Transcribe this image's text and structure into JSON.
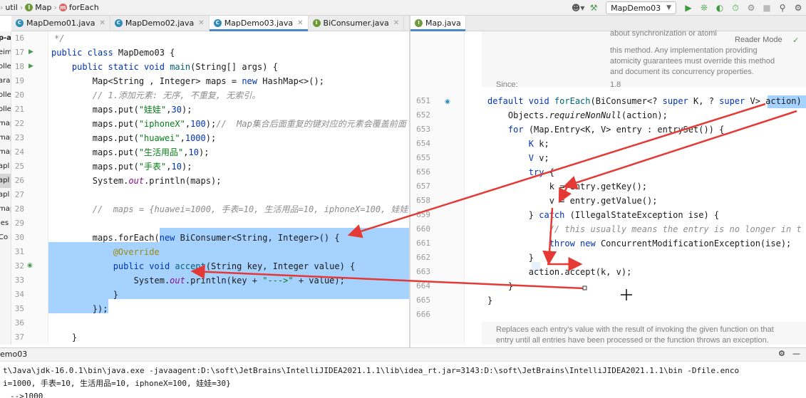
{
  "breadcrumb": {
    "items": [
      "util",
      "Map",
      "forEach"
    ]
  },
  "toolbar": {
    "run_config": "MapDemo03"
  },
  "left_tabs": [
    {
      "label": "MapDemo01.java"
    },
    {
      "label": "MapDemo02.java"
    },
    {
      "label": "MapDemo03.java"
    },
    {
      "label": "BiConsumer.java"
    }
  ],
  "right_tabs": [
    {
      "label": "Map.java"
    }
  ],
  "project_strip": [
    "p-a",
    "eim",
    "olle",
    "ara",
    "olle",
    "olle",
    "map",
    "map",
    "map",
    "apl",
    "apl",
    "apl",
    "map",
    "ies",
    "Co"
  ],
  "inspection": {
    "warnings": "⚠ 2",
    "weak": "⚠ 1"
  },
  "left_code": {
    "line_numbers": [
      "16",
      "17",
      "18",
      "19",
      "20",
      "21",
      "22",
      "23",
      "24",
      "25",
      "26",
      "27",
      "28",
      "29",
      "30",
      "31",
      "32",
      "33",
      "34",
      "35",
      "36",
      "37"
    ],
    "lines": [
      "*/",
      "public class MapDemo03 {",
      "    public static void main(String[] args) {",
      "        Map<String , Integer> maps = new HashMap<>();",
      "        // 1.添加元素: 无序, 不重复, 无索引。",
      "        maps.put(\"娃娃\",30);",
      "        maps.put(\"iphoneX\",100);//  Map集合后面重复的键对应的元素会覆盖前面",
      "        maps.put(\"huawei\",1000);",
      "        maps.put(\"生活用品\",10);",
      "        maps.put(\"手表\",10);",
      "        System.out.println(maps);",
      "",
      "        //  maps = {huawei=1000, 手表=10, 生活用品=10, iphoneX=100, 娃娃",
      "",
      "        maps.forEach(new BiConsumer<String, Integer>() {",
      "            @Override",
      "            public void accept(String key, Integer value) {",
      "                System.out.println(key + \"--->\" + value);",
      "            }",
      "        });",
      "",
      "    }"
    ]
  },
  "right_doc_top": {
    "lines": [
      "about synchronization or atomi",
      "this method. Any implementation providing",
      "atomicity guarantees must override this method",
      "and document its concurrency properties."
    ],
    "reader_mode": "Reader Mode",
    "since_label": "Since:",
    "since_value": "1.8"
  },
  "right_code": {
    "line_numbers": [
      "651",
      "652",
      "653",
      "654",
      "655",
      "656",
      "657",
      "658",
      "659",
      "660",
      "661",
      "662",
      "663",
      "664",
      "665",
      "666"
    ],
    "lines": [
      "default void forEach(BiConsumer<? super K, ? super V> action)",
      "    Objects.requireNonNull(action);",
      "    for (Map.Entry<K, V> entry : entrySet()) {",
      "        K k;",
      "        V v;",
      "        try {",
      "            k = entry.getKey();",
      "            v = entry.getValue();",
      "        } catch (IllegalStateException ise) {",
      "            // this usually means the entry is no longer in t",
      "            throw new ConcurrentModificationException(ise);",
      "        }",
      "        action.accept(k, v);",
      "    }",
      "}",
      ""
    ]
  },
  "right_doc_bottom": {
    "lines": [
      "Replaces each entry's value with the result of invoking the given function on that",
      "entry until all entries have been processed or the function throws an exception."
    ]
  },
  "run_panel": {
    "tab_label": "emo03",
    "output": [
      "t\\Java\\jdk-16.0.1\\bin\\java.exe -javaagent:D:\\soft\\JetBrains\\IntelliJIDEA2021.1.1\\lib\\idea_rt.jar=3143:D:\\soft\\JetBrains\\IntelliJIDEA2021.1.1\\bin -Dfile.enco",
      "i=1000, 手表=10, 生活用品=10, iphoneX=100, 娃娃=30}",
      "-->1000"
    ]
  },
  "colors": {
    "selection": "#a6d2ff",
    "arrow": "#e53935",
    "keyword": "#0033b3",
    "string": "#067d17",
    "comment": "#8c8c8c"
  }
}
